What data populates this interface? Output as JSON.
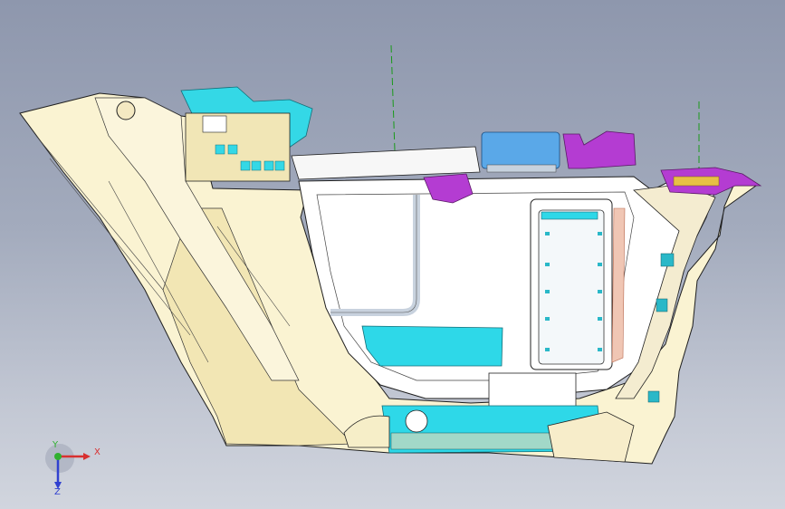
{
  "viewport": {
    "background_top": "#8e97ad",
    "background_bottom": "#d1d5de"
  },
  "model": {
    "colors": {
      "trim_body": "#faf3d2",
      "trim_shade": "#efe2ad",
      "inner_panel": "#ffffff",
      "edge": "#1e1e1e",
      "cyan_part": "#2ed8e8",
      "blue_part": "#5aa8e8",
      "purple_part": "#b43cd2",
      "pink_part": "#f0b4a0",
      "bracket_teal": "#2ab8c8"
    }
  },
  "axis_triad": {
    "x_label": "X",
    "y_label": "Y",
    "z_label": "Z",
    "x_color": "#d83030",
    "y_color": "#30b030",
    "z_color": "#3040d0"
  }
}
